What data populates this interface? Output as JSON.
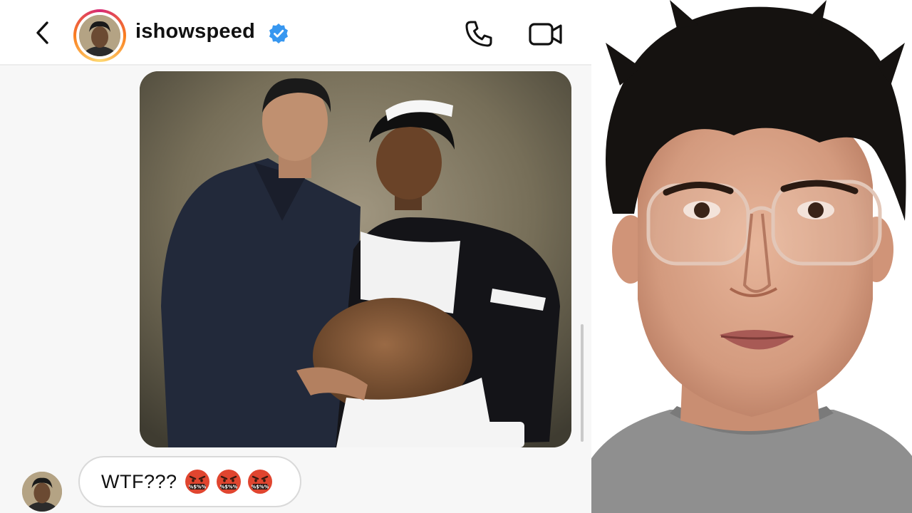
{
  "header": {
    "username": "ishowspeed",
    "verified": true,
    "back_icon": "chevron-left-icon",
    "call_icon": "phone-icon",
    "video_icon": "video-camera-icon"
  },
  "messages": [
    {
      "type": "image",
      "description_icon": "photo"
    },
    {
      "type": "text",
      "text": "WTF???",
      "emojis": [
        "face-with-symbols-on-mouth",
        "face-with-symbols-on-mouth",
        "face-with-symbols-on-mouth"
      ]
    }
  ],
  "colors": {
    "verified_blue": "#3797f0",
    "story_ring_start": "#d62976",
    "story_ring_end": "#feda75",
    "emoji_red": "#e0452f"
  }
}
